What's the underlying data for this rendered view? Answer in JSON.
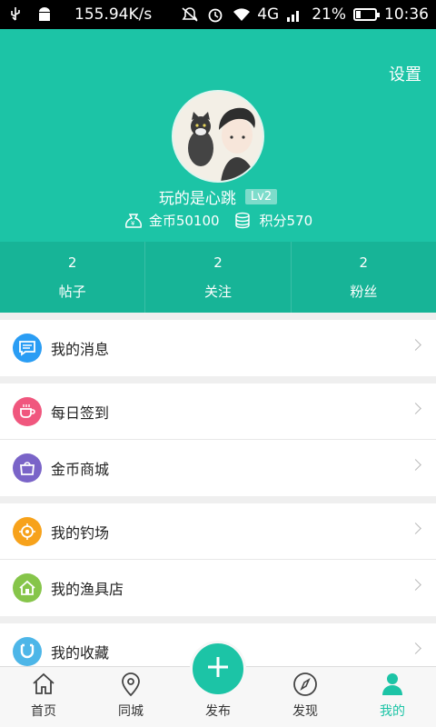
{
  "status_bar": {
    "speed": "155.94K/s",
    "network": "4G",
    "battery": "21%",
    "time": "10:36"
  },
  "header": {
    "settings_label": "设置",
    "username": "玩的是心跳",
    "level": "Lv2",
    "coins": "金币50100",
    "points": "积分570",
    "accent": "#1cc4a6"
  },
  "stats": [
    {
      "value": "2",
      "label": "帖子"
    },
    {
      "value": "2",
      "label": "关注"
    },
    {
      "value": "2",
      "label": "粉丝"
    }
  ],
  "menu": {
    "messages": {
      "label": "我的消息",
      "icon": "message-icon",
      "color": "#2a9df4"
    },
    "checkin": {
      "label": "每日签到",
      "icon": "cup-icon",
      "color": "#f0577e"
    },
    "mall": {
      "label": "金币商城",
      "icon": "bag-icon",
      "color": "#7a64c8"
    },
    "fishing_spot": {
      "label": "我的钓场",
      "icon": "target-icon",
      "color": "#f7a21b"
    },
    "tackle_shop": {
      "label": "我的渔具店",
      "icon": "house-icon",
      "color": "#86c54a"
    },
    "favorites": {
      "label": "我的收藏",
      "icon": "magnet-icon",
      "color": "#4db6e8"
    }
  },
  "bottom_nav": {
    "home": "首页",
    "local": "同城",
    "publish": "发布",
    "discover": "发现",
    "mine": "我的"
  }
}
